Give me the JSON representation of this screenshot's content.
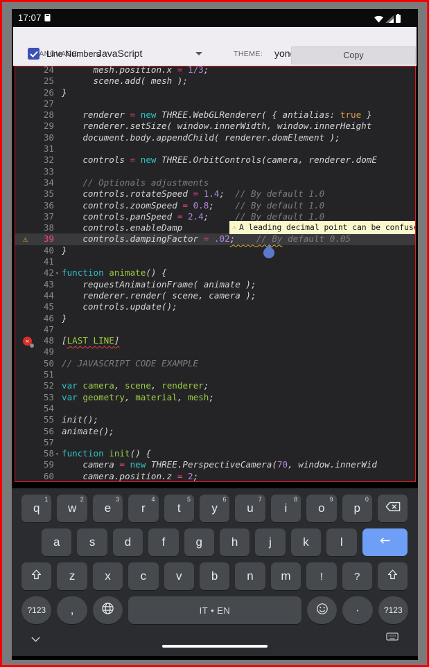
{
  "status_bar": {
    "time": "17:07",
    "icons": [
      "screenshot-icon",
      "wifi-icon",
      "signal-icon",
      "battery-icon"
    ]
  },
  "toolbar": {
    "language_label": "LANGUAGE:",
    "language_value": "JavaScript",
    "theme_label": "THEME:",
    "theme_value": "yonce",
    "line_numbers_label": "Line Numbers",
    "line_numbers_checked": true,
    "copy_label": "Copy"
  },
  "colors": {
    "frame_border": "#f20000",
    "checkbox": "#3c51b5",
    "enter_key": "#6f9ef7",
    "editor_bg": "#242426",
    "active_line": "#3a3a3d",
    "active_line_number": "#fb4386",
    "keyword": "#30c2c9",
    "definition": "#9ccc42",
    "operator": "#fc4384",
    "number": "#b487dd",
    "atom": "#de9a4a",
    "comment": "#7d7d7d",
    "tooltip_bg": "#fbf7cc",
    "warning": "#f0ad1f",
    "error": "#d93025",
    "handle": "#5a79cb"
  },
  "editor": {
    "tooltip": {
      "icon": "warning-icon",
      "text": "A leading decimal point can be confused wi"
    },
    "lines": [
      {
        "n": 24,
        "t": [
          [
            "t",
            "      mesh.position.x "
          ],
          [
            "o",
            "="
          ],
          [
            "t",
            " "
          ],
          [
            "n",
            "1/3"
          ],
          [
            "t",
            ";"
          ]
        ]
      },
      {
        "n": 25,
        "t": [
          [
            "t",
            "      scene.add( mesh );"
          ]
        ]
      },
      {
        "n": 26,
        "t": [
          [
            "t",
            "}"
          ]
        ]
      },
      {
        "n": 27,
        "t": []
      },
      {
        "n": 28,
        "t": [
          [
            "t",
            "    renderer "
          ],
          [
            "o",
            "="
          ],
          [
            "t",
            " "
          ],
          [
            "k",
            "new"
          ],
          [
            "t",
            " THREE.WebGLRenderer( { antialias: "
          ],
          [
            "a",
            "true"
          ],
          [
            "t",
            " }"
          ]
        ]
      },
      {
        "n": 29,
        "t": [
          [
            "t",
            "    renderer.setSize( window.innerWidth, window.innerHeight"
          ]
        ]
      },
      {
        "n": 30,
        "t": [
          [
            "t",
            "    document.body.appendChild( renderer.domElement );"
          ]
        ]
      },
      {
        "n": 31,
        "t": []
      },
      {
        "n": 32,
        "t": [
          [
            "t",
            "    controls "
          ],
          [
            "o",
            "="
          ],
          [
            "t",
            " "
          ],
          [
            "k",
            "new"
          ],
          [
            "t",
            " THREE.OrbitControls(camera, renderer.domE"
          ]
        ]
      },
      {
        "n": 33,
        "t": []
      },
      {
        "n": 34,
        "t": [
          [
            "c",
            "    // Optionals adjustments"
          ]
        ]
      },
      {
        "n": 35,
        "t": [
          [
            "t",
            "    controls.rotateSpeed "
          ],
          [
            "o",
            "="
          ],
          [
            "t",
            " "
          ],
          [
            "n",
            "1.4"
          ],
          [
            "t",
            ";  "
          ],
          [
            "c",
            "// By default 1.0"
          ]
        ]
      },
      {
        "n": 36,
        "t": [
          [
            "t",
            "    controls.zoomSpeed "
          ],
          [
            "o",
            "="
          ],
          [
            "t",
            " "
          ],
          [
            "n",
            "0.8"
          ],
          [
            "t",
            ";    "
          ],
          [
            "c",
            "// By default 1.0"
          ]
        ]
      },
      {
        "n": 37,
        "t": [
          [
            "t",
            "    controls.panSpeed "
          ],
          [
            "o",
            "="
          ],
          [
            "t",
            " "
          ],
          [
            "n",
            "2.4"
          ],
          [
            "t",
            ";     "
          ],
          [
            "c",
            "// By default 1.0"
          ]
        ]
      },
      {
        "n": 38,
        "t": [
          [
            "t",
            "    controls.enableDamp"
          ]
        ]
      },
      {
        "n": 39,
        "active": true,
        "marker": "warning",
        "t": [
          [
            "t",
            "    controls.dampingFactor "
          ],
          [
            "o",
            "="
          ],
          [
            "t",
            " "
          ],
          [
            "n",
            ".02"
          ],
          [
            "tw",
            ";    "
          ],
          [
            "cw",
            "// By"
          ],
          [
            "c",
            " default 0.05"
          ]
        ]
      },
      {
        "n": 40,
        "t": [
          [
            "t",
            "}"
          ]
        ]
      },
      {
        "n": 41,
        "t": []
      },
      {
        "n": 42,
        "fold": true,
        "t": [
          [
            "k",
            "function"
          ],
          [
            "t",
            " "
          ],
          [
            "d",
            "animate"
          ],
          [
            "t",
            "() {"
          ]
        ]
      },
      {
        "n": 43,
        "t": [
          [
            "t",
            "    requestAnimationFrame( animate );"
          ]
        ]
      },
      {
        "n": 44,
        "t": [
          [
            "t",
            "    renderer.render( scene, camera );"
          ]
        ]
      },
      {
        "n": 45,
        "t": [
          [
            "t",
            "    controls.update();"
          ]
        ]
      },
      {
        "n": 46,
        "t": [
          [
            "t",
            "}"
          ]
        ]
      },
      {
        "n": 47,
        "t": []
      },
      {
        "n": 48,
        "marker": "error",
        "t": [
          [
            "t",
            "["
          ],
          [
            "gw",
            "LAST LINE"
          ],
          [
            "tr",
            "]"
          ]
        ]
      },
      {
        "n": 49,
        "t": []
      },
      {
        "n": 50,
        "t": [
          [
            "c",
            "// JAVASCRIPT CODE EXAMPLE"
          ]
        ]
      },
      {
        "n": 51,
        "t": []
      },
      {
        "n": 52,
        "t": [
          [
            "k",
            "var"
          ],
          [
            "t",
            " "
          ],
          [
            "d",
            "camera"
          ],
          [
            "t",
            ", "
          ],
          [
            "d",
            "scene"
          ],
          [
            "t",
            ", "
          ],
          [
            "d",
            "renderer"
          ],
          [
            "t",
            ";"
          ]
        ]
      },
      {
        "n": 53,
        "t": [
          [
            "k",
            "var"
          ],
          [
            "t",
            " "
          ],
          [
            "d",
            "geometry"
          ],
          [
            "t",
            ", "
          ],
          [
            "d",
            "material"
          ],
          [
            "t",
            ", "
          ],
          [
            "d",
            "mesh"
          ],
          [
            "t",
            ";"
          ]
        ]
      },
      {
        "n": 54,
        "t": []
      },
      {
        "n": 55,
        "t": [
          [
            "t",
            "init();"
          ]
        ]
      },
      {
        "n": 56,
        "t": [
          [
            "t",
            "animate();"
          ]
        ]
      },
      {
        "n": 57,
        "t": []
      },
      {
        "n": 58,
        "fold": true,
        "t": [
          [
            "k",
            "function"
          ],
          [
            "t",
            " "
          ],
          [
            "d",
            "init"
          ],
          [
            "t",
            "() {"
          ]
        ]
      },
      {
        "n": 59,
        "t": [
          [
            "t",
            "    camera "
          ],
          [
            "o",
            "="
          ],
          [
            "t",
            " "
          ],
          [
            "k",
            "new"
          ],
          [
            "t",
            " THREE.PerspectiveCamera("
          ],
          [
            "n",
            "70"
          ],
          [
            "t",
            ", window.innerWid"
          ]
        ]
      },
      {
        "n": 60,
        "t": [
          [
            "t",
            "    camera.position.z "
          ],
          [
            "o",
            "="
          ],
          [
            "t",
            " "
          ],
          [
            "n",
            "2"
          ],
          [
            "t",
            ";"
          ]
        ]
      }
    ]
  },
  "keyboard": {
    "space_label": "IT • EN",
    "rows": [
      [
        {
          "l": "q",
          "s": "1"
        },
        {
          "l": "w",
          "s": "2"
        },
        {
          "l": "e",
          "s": "3"
        },
        {
          "l": "r",
          "s": "4"
        },
        {
          "l": "t",
          "s": "5"
        },
        {
          "l": "y",
          "s": "6"
        },
        {
          "l": "u",
          "s": "7"
        },
        {
          "l": "i",
          "s": "8"
        },
        {
          "l": "o",
          "s": "9"
        },
        {
          "l": "p",
          "s": "0"
        },
        {
          "icon": "backspace-icon"
        }
      ],
      [
        {
          "l": "a"
        },
        {
          "l": "s"
        },
        {
          "l": "d"
        },
        {
          "l": "f"
        },
        {
          "l": "g"
        },
        {
          "l": "h"
        },
        {
          "l": "j"
        },
        {
          "l": "k"
        },
        {
          "l": "l"
        },
        {
          "icon": "enter-icon",
          "accent": true
        }
      ],
      [
        {
          "icon": "shift-icon"
        },
        {
          "l": "z"
        },
        {
          "l": "x"
        },
        {
          "l": "c"
        },
        {
          "l": "v"
        },
        {
          "l": "b"
        },
        {
          "l": "n"
        },
        {
          "l": "m"
        },
        {
          "l": "!",
          "sym": true
        },
        {
          "l": "?",
          "sym": true
        },
        {
          "icon": "shift-icon"
        }
      ],
      [
        {
          "l": "?123",
          "small": true,
          "round": true
        },
        {
          "l": ",",
          "round": true
        },
        {
          "icon": "globe-icon",
          "round": true
        },
        {
          "space": true
        },
        {
          "icon": "emoji-icon",
          "round": true
        },
        {
          "l": "·",
          "round": true
        },
        {
          "l": "?123",
          "small": true,
          "round": true
        }
      ]
    ],
    "bottom": [
      "chevron-down-icon",
      "nav-handle",
      "keyboard-hide-icon"
    ]
  }
}
